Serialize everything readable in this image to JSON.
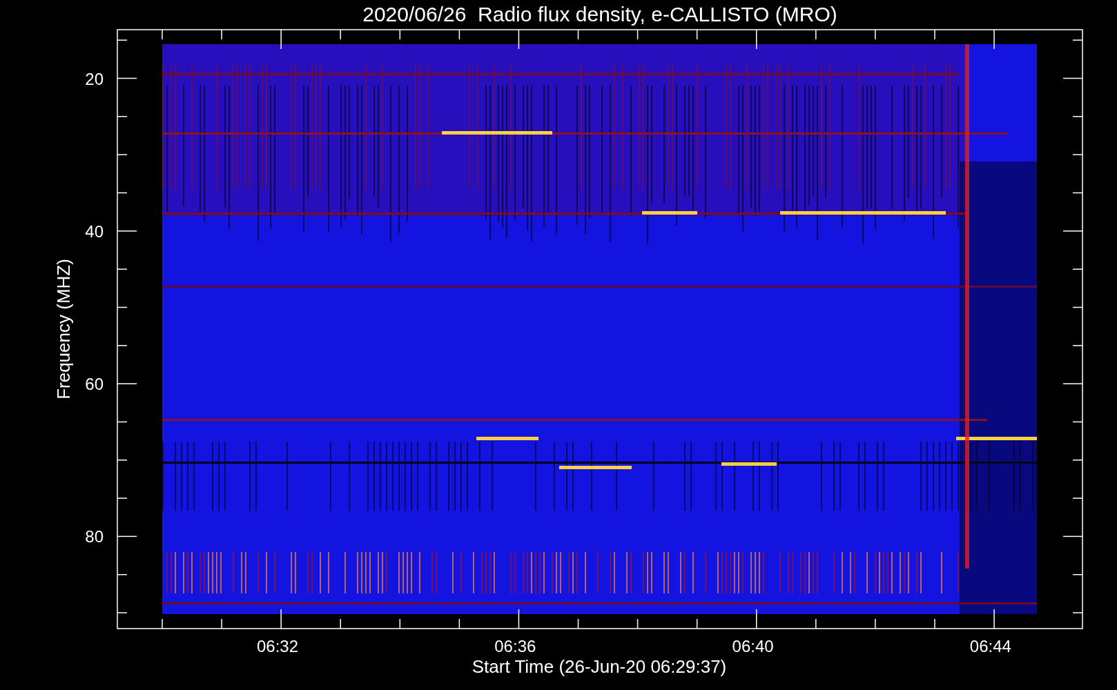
{
  "title": "2020/06/26  Radio flux density, e-CALLISTO (MRO)",
  "y_axis": {
    "label": "Frequency (MHZ)",
    "ticks": [
      "20",
      "40",
      "60",
      "80"
    ]
  },
  "x_axis": {
    "label": "Start Time (26-Jun-20 06:29:37)",
    "ticks": [
      "06:32",
      "06:36",
      "06:40",
      "06:44"
    ]
  }
}
